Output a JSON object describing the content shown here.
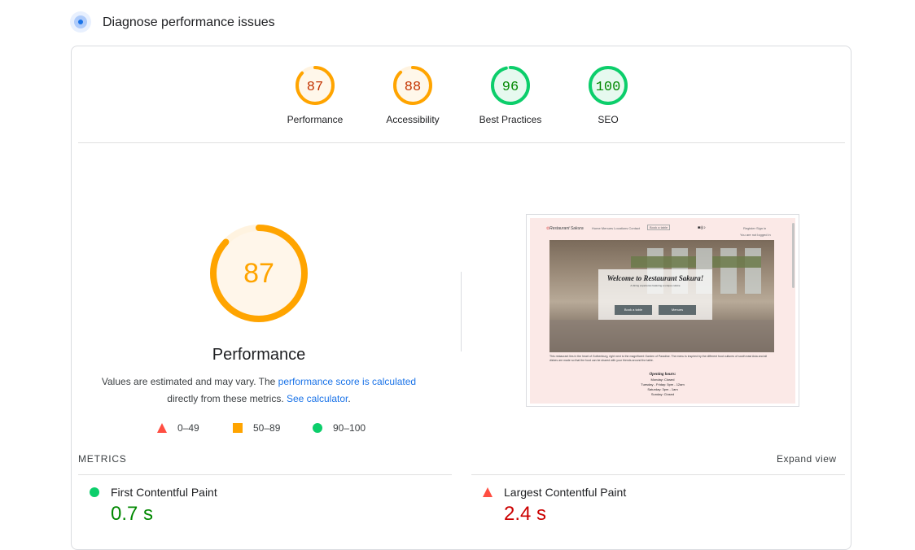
{
  "header": {
    "title": "Diagnose performance issues",
    "icon": "lighthouse-icon",
    "icon_color": "#1a73e8"
  },
  "colors": {
    "good": "#0cce6b",
    "good_text": "#008800",
    "average": "#ffa400",
    "average_text": "#c33300",
    "poor": "#ff4e42",
    "poor_text": "#cc0000"
  },
  "scores": [
    {
      "label": "Performance",
      "value": 87,
      "rating": "average"
    },
    {
      "label": "Accessibility",
      "value": 88,
      "rating": "average"
    },
    {
      "label": "Best Practices",
      "value": 96,
      "rating": "good"
    },
    {
      "label": "SEO",
      "value": 100,
      "rating": "good"
    }
  ],
  "performance": {
    "score": 87,
    "title": "Performance",
    "desc_prefix": "Values are estimated and may vary. The ",
    "desc_link1": "performance score is calculated",
    "desc_middle": "directly from these metrics. ",
    "desc_link2": "See calculator",
    "desc_suffix": "."
  },
  "legend": [
    {
      "shape": "triangle",
      "range": "0–49",
      "color": "#ff4e42"
    },
    {
      "shape": "square",
      "range": "50–89",
      "color": "#ffa400"
    },
    {
      "shape": "circle",
      "range": "90–100",
      "color": "#0cce6b"
    }
  ],
  "screenshot": {
    "brand": "Restaurant Sakura",
    "nav_links": "Home   Menues   Locations   Contact",
    "booking": "Book a table",
    "auth": "Register   Sign in",
    "not_logged_in": "You are not logged in",
    "welcome": "Welcome to Restaurant Sakura!",
    "tagline": "A dining experience featuring a unique cuisine",
    "button1": "Book a table",
    "button2": "Menues",
    "body_text": "This restaurant lies in the heart of Gothenburg, right next to the magnificent Garden of Paradise. The menu is inspired by the different food cultures of south east Asia and all dishes are made so that the food can be shared with your friends around the table.",
    "hours_title": "Opening hours:",
    "hours": [
      "Monday: Closed",
      "Tuesday - Friday: 5pm - 12am",
      "Saturday: 3pm - 1am",
      "Sunday: Closed"
    ]
  },
  "metrics": {
    "label": "METRICS",
    "expand": "Expand view",
    "items": [
      {
        "name": "First Contentful Paint",
        "value": "0.7 s",
        "rating": "good"
      },
      {
        "name": "Largest Contentful Paint",
        "value": "2.4 s",
        "rating": "poor"
      }
    ]
  }
}
